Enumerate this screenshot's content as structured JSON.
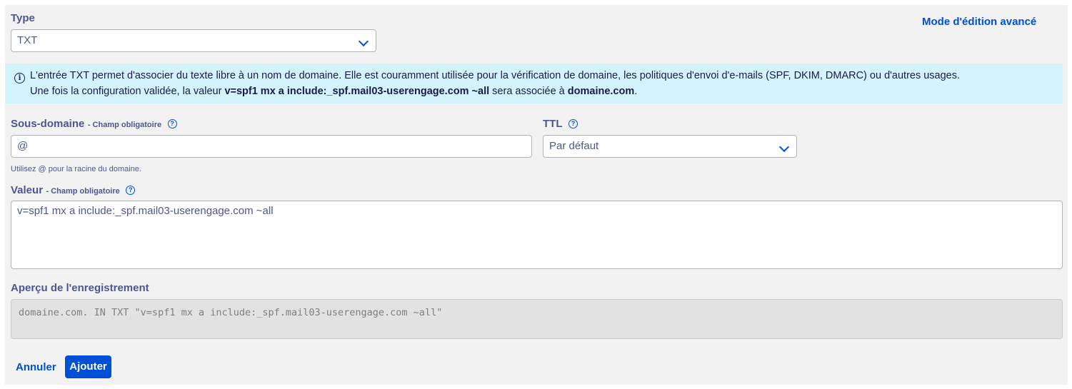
{
  "type_field": {
    "label": "Type",
    "value": "TXT"
  },
  "advanced_mode_link": "Mode d'édition avancé",
  "info_box": {
    "line1": "L'entrée TXT permet d'associer du texte libre à un nom de domaine. Elle est couramment utilisée pour la vérification de domaine, les politiques d'envoi d'e-mails (SPF, DKIM, DMARC) ou d'autres usages.",
    "line2_prefix": "Une fois la configuration validée, la valeur ",
    "line2_value": "v=spf1 mx a include:_spf.mail03-userengage.com ~all",
    "line2_middle": " sera associée à ",
    "line2_domain": "domaine.com",
    "line2_suffix": "."
  },
  "subdomain_field": {
    "label": "Sous-domaine",
    "required": "- Champ obligatoire",
    "value": "@",
    "hint": "Utilisez @ pour la racine du domaine."
  },
  "ttl_field": {
    "label": "TTL",
    "value": "Par défaut"
  },
  "value_field": {
    "label": "Valeur",
    "required": "- Champ obligatoire",
    "value": "v=spf1 mx a include:_spf.mail03-userengage.com ~all"
  },
  "preview": {
    "label": "Aperçu de l'enregistrement",
    "text": "domaine.com. IN TXT \"v=spf1 mx a include:_spf.mail03-userengage.com ~all\""
  },
  "actions": {
    "cancel": "Annuler",
    "submit": "Ajouter"
  },
  "colors": {
    "accent": "#0050d7",
    "info_background": "#d3f3fd",
    "label_text": "#4d5693"
  },
  "icons": {
    "help": "question-circle-icon",
    "info": "info-circle-icon",
    "dropdown": "chevron-down-icon"
  }
}
